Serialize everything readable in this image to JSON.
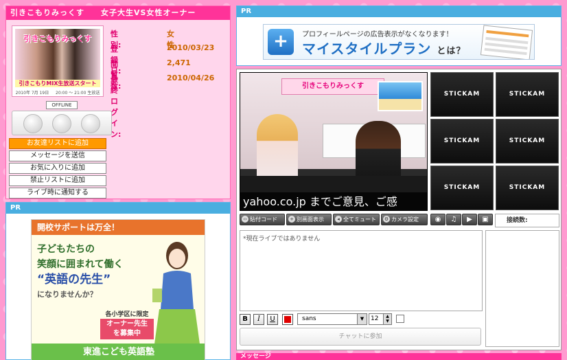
{
  "profile": {
    "title": "引きこもりみっくす　　女子大生VS女性オーナー",
    "avatar": {
      "title": "引きこもりみっくす",
      "banner": "引きこもりMIX生放送スタート",
      "date": "2010年 7月 19日 　 20:00 〜 21:00 生放送決定！"
    },
    "fields": [
      {
        "key": "性別:",
        "value": "女性"
      },
      {
        "key": "登録日:",
        "value": "2010/03/23"
      },
      {
        "key": "閲覧数:",
        "value": "2,471"
      },
      {
        "key": "最終ログイン:",
        "value": "2010/04/26"
      }
    ],
    "status_badge": "OFFLINE",
    "buttons": {
      "add_friend": "お友達リストに追加",
      "send_message": "メッセージを送信",
      "add_favorite": "お気に入りに追加",
      "add_block": "禁止リストに追加",
      "notify_live": "ライブ時に通知する"
    }
  },
  "pr_left": {
    "header": "PR",
    "ad": {
      "top": "開校サポートは万全！",
      "line1": "子どもたちの",
      "line2": "笑顔に囲まれて働く",
      "line3": "“英語の先生”",
      "line4": "になりませんか？",
      "limit": "各小学区に限定１名",
      "owner1": "オーナー先生",
      "owner2": "を募集中",
      "footer": "東進こども英語塾"
    }
  },
  "pr_right": {
    "header": "PR",
    "ad": {
      "line1": "プロフィールページの広告表示がなくなります！",
      "line2": "マイスタイルプラン",
      "line2_suffix": "とは？"
    }
  },
  "live": {
    "video": {
      "poster": "引きこもりみっくす",
      "caption": "yahoo.co.jp までご意見、ご感"
    },
    "cam_label": "STICKAM",
    "buttons": {
      "embed_code": "貼付コード",
      "popout": "別画面表示",
      "mute_all": "全てミュート",
      "camera_settings": "カメラ設定"
    },
    "viewer_label": "接続数:",
    "chat_placeholder": "*現在ライブではありません",
    "format": {
      "bold": "B",
      "italic": "I",
      "underline": "U",
      "font": "sans",
      "size": "12"
    },
    "join_chat": "チャットに参加"
  },
  "message_header": "メッセージ",
  "colors": {
    "pink_header": "#ff3399",
    "blue_header": "#4aaee0",
    "orange_button": "#ff9900"
  }
}
